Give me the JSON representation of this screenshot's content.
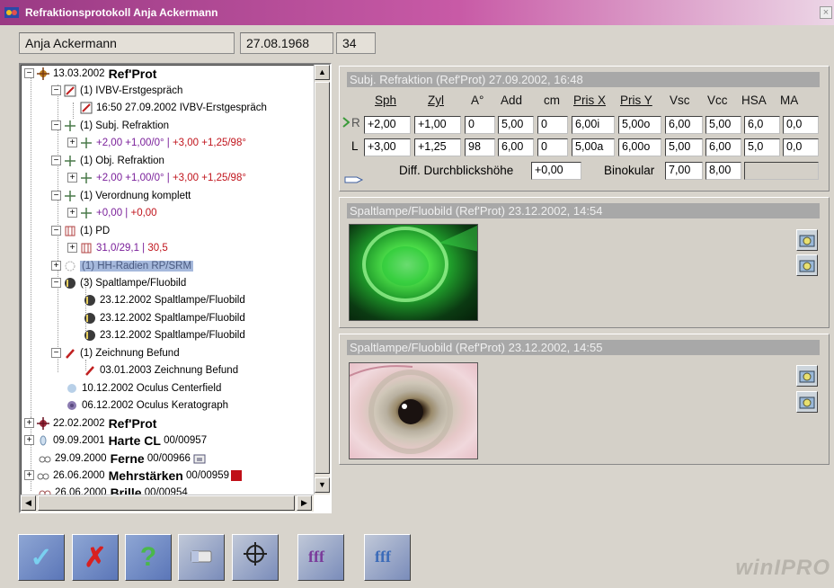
{
  "window": {
    "title": "Refraktionsprotokoll Anja Ackermann"
  },
  "patient": {
    "name": "Anja Ackermann",
    "dob": "27.08.1968",
    "age": "34"
  },
  "tree": {
    "n1": {
      "date": "13.03.2002",
      "bold": "Ref'Prot"
    },
    "n2": "(1) IVBV-Erstgespräch",
    "n3": "16:50 27.09.2002 IVBV-Erstgespräch",
    "n4": "(1) Subj. Refraktion",
    "n5a": "+2,00 +1,00/0° |",
    "n5b": "+3,00 +1,25/98°",
    "n6": "(1) Obj. Refraktion",
    "n7a": "+2,00 +1,00/0° |",
    "n7b": "+3,00 +1,25/98°",
    "n8": "(1) Verordnung komplett",
    "n9a": "+0,00 |",
    "n9b": "+0,00",
    "n10": "(1) PD",
    "n11a": "31,0/29,1 |",
    "n11b": "30,5",
    "n12": "(1) HH-Radien RP/SRM",
    "n13": "(3) Spaltlampe/Fluobild",
    "n14": "23.12.2002 Spaltlampe/Fluobild",
    "n15": "23.12.2002 Spaltlampe/Fluobild",
    "n16": "23.12.2002 Spaltlampe/Fluobild",
    "n17": "(1) Zeichnung Befund",
    "n18": "03.01.2003 Zeichnung Befund",
    "n19": "10.12.2002 Oculus Centerfield",
    "n20": "06.12.2002 Oculus Keratograph",
    "n21": {
      "date": "22.02.2002",
      "bold": "Ref'Prot"
    },
    "n22": {
      "date": "09.09.2001",
      "bold": "Harte CL",
      "extra": "00/00957"
    },
    "n23": {
      "date": "29.09.2000",
      "bold": "Ferne",
      "extra": "00/00966"
    },
    "n24": {
      "date": "26.06.2000",
      "bold": "Mehrstärken",
      "extra": "00/00959"
    },
    "n25": {
      "date": "26.06.2000",
      "bold": "Brille",
      "extra": "00/00954"
    }
  },
  "refraction": {
    "header": "Subj. Refraktion (Ref'Prot) 27.09.2002, 16:48",
    "columns": [
      "Sph",
      "Zyl",
      "A°",
      "Add",
      "cm",
      "Pris X",
      "Pris Y",
      "Vsc",
      "Vcc",
      "HSA",
      "MA"
    ],
    "rows": [
      {
        "label": "R",
        "values": [
          "+2,00",
          "+1,00",
          "0",
          "5,00",
          "0",
          "6,00i",
          "5,00o",
          "6,00",
          "5,00",
          "6,0",
          "0,0"
        ]
      },
      {
        "label": "L",
        "values": [
          "+3,00",
          "+1,25",
          "98",
          "6,00",
          "0",
          "5,00a",
          "6,00o",
          "5,00",
          "6,00",
          "5,0",
          "0,0"
        ]
      }
    ],
    "diff_label": "Diff. Durchblickshöhe",
    "diff_value": "+0,00",
    "binokular_label": "Binokular",
    "binokular_vsc": "7,00",
    "binokular_vcc": "8,00"
  },
  "slit1": {
    "header": "Spaltlampe/Fluobild (Ref'Prot) 23.12.2002, 14:54"
  },
  "slit2": {
    "header": "Spaltlampe/Fluobild (Ref'Prot) 23.12.2002, 14:55"
  },
  "footer": {
    "wordmark": "winIPRO"
  },
  "icons": [
    "app-icon",
    "close-icon",
    "protocol-icon",
    "notepad-icon",
    "cross-icon",
    "pd-icon",
    "radius-icon",
    "slitlamp-icon",
    "pencil-icon",
    "disc-icon",
    "contact-lens-icon",
    "glasses-icon",
    "camera-icon",
    "checkmark-icon",
    "x-icon",
    "question-icon",
    "eraser-icon",
    "crosshair-icon",
    "fff-icon"
  ]
}
